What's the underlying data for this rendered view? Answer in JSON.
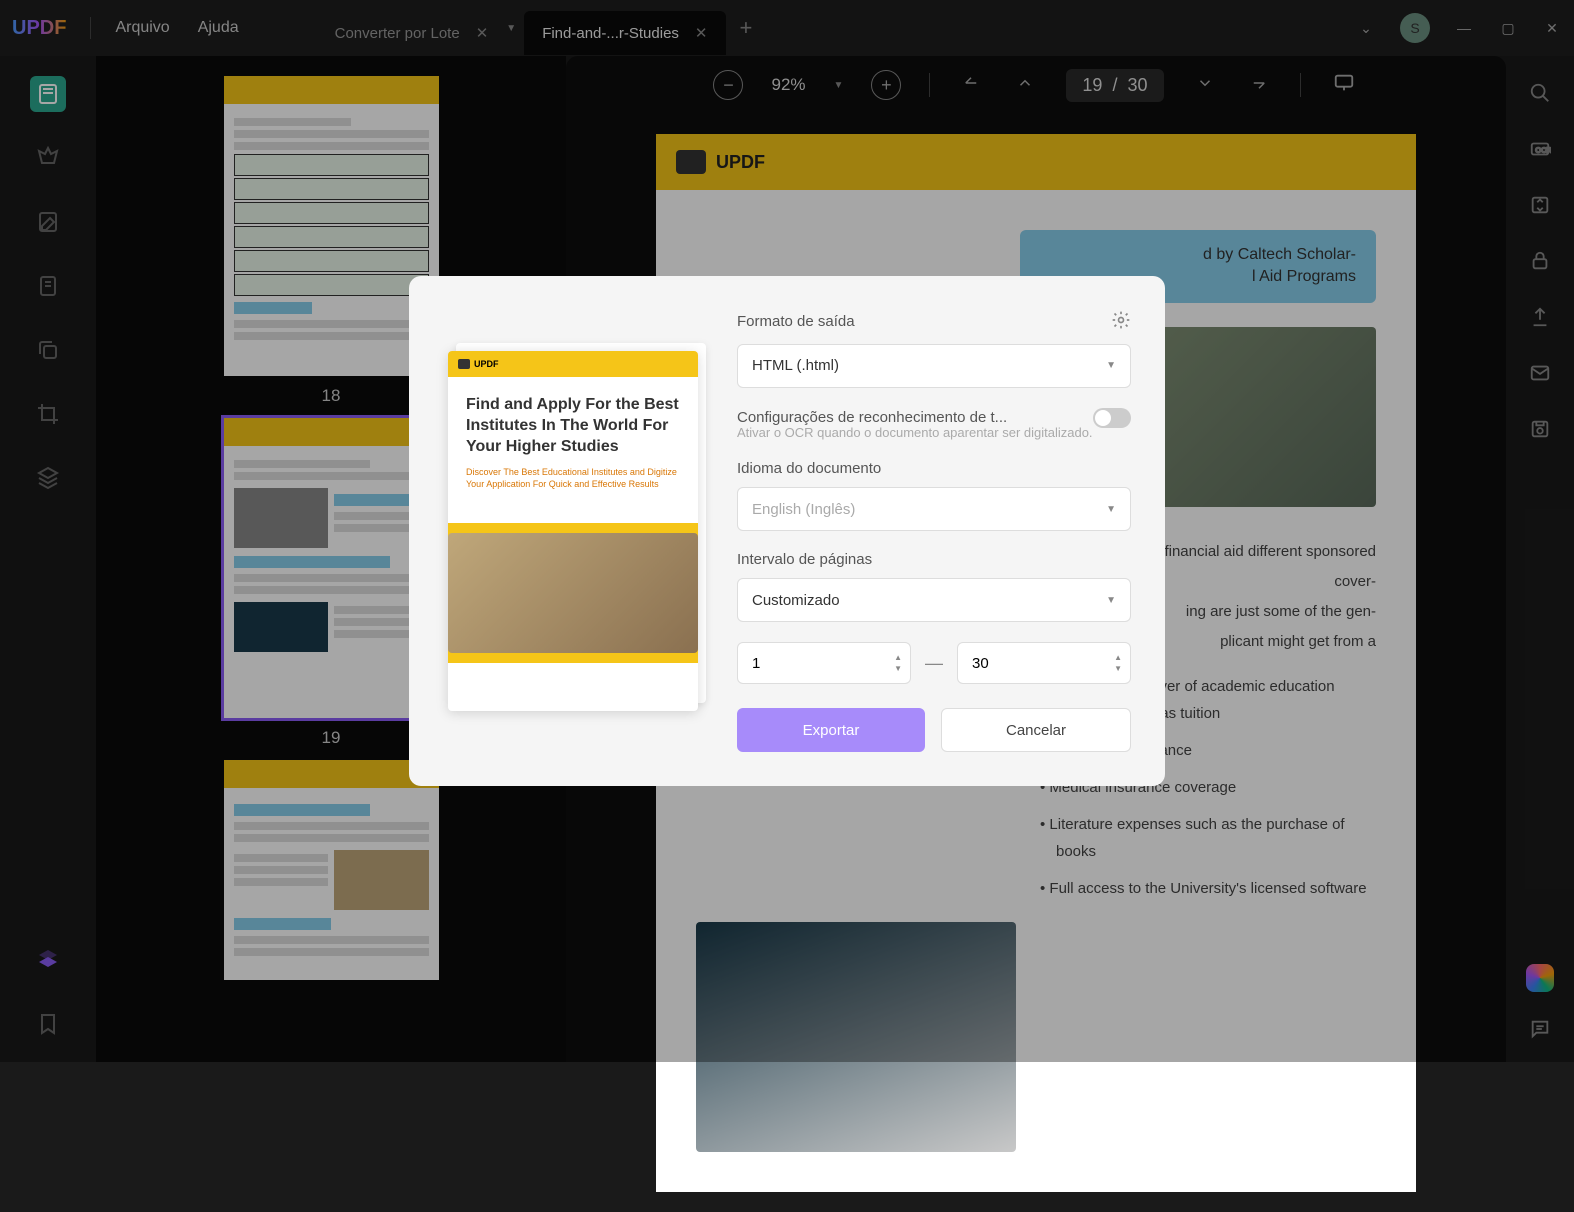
{
  "app": {
    "logo": "UPDF"
  },
  "menu": {
    "file": "Arquivo",
    "help": "Ajuda"
  },
  "tabs": {
    "items": [
      {
        "label": "Converter por Lote",
        "active": false
      },
      {
        "label": "Find-and-...r-Studies",
        "active": true
      }
    ],
    "avatar_initial": "S"
  },
  "toolbar": {
    "zoom": "92%",
    "page_current": "19",
    "page_sep": "/",
    "page_total": "30"
  },
  "thumbnails": {
    "items": [
      {
        "num": "18"
      },
      {
        "num": "19"
      }
    ]
  },
  "document": {
    "brand": "UPDF",
    "callout": "d by Caltech Scholar-\nl Aid Programs",
    "para1": "holarships and financial aid different sponsored cover-\ning are just some of the gen-\nplicant might get from a",
    "bullets": [
      "Partial or full waiver of academic education expenses such as tuition",
      "Daily living allowance",
      "Medical insurance coverage",
      "Literature expenses such as the purchase of books",
      "Full access to the University's licensed software"
    ]
  },
  "modal": {
    "preview": {
      "brand": "UPDF",
      "title": "Find and Apply For the Best Institutes In The World For Your Higher Studies",
      "subtitle": "Discover The Best Educational Institutes and Digitize Your Application For Quick and Effective Results"
    },
    "output_format_label": "Formato de saída",
    "output_format_value": "HTML (.html)",
    "ocr_label": "Configurações de reconhecimento de t...",
    "ocr_hint": "Ativar o OCR quando o documento aparentar ser digitalizado.",
    "language_label": "Idioma do documento",
    "language_value": "English (Inglês)",
    "range_label": "Intervalo de páginas",
    "range_value": "Customizado",
    "range_from": "1",
    "range_to": "30",
    "export_btn": "Exportar",
    "cancel_btn": "Cancelar"
  }
}
